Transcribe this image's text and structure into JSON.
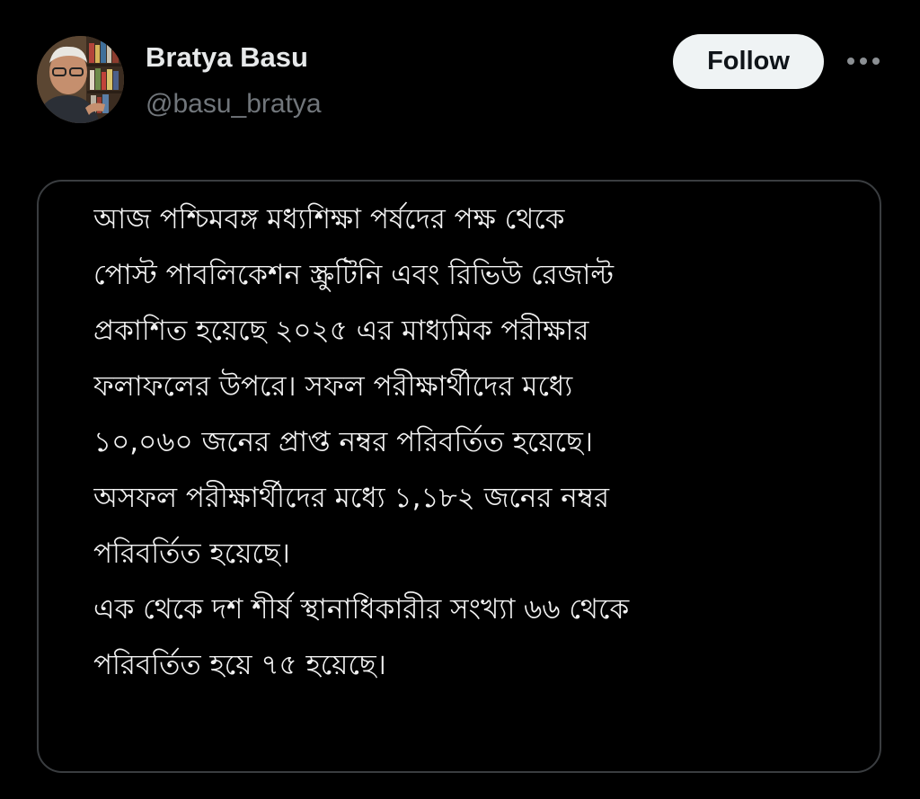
{
  "author": {
    "name": "Bratya Basu",
    "handle": "@basu_bratya"
  },
  "actions": {
    "follow_label": "Follow",
    "more_icon": "more-horizontal-icon"
  },
  "post_image": {
    "lines": [
      "আজ পশ্চিমবঙ্গ মধ্যশিক্ষা পর্ষদের পক্ষ থেকে",
      "পোস্ট পাবলিকেশন স্ক্রুটিনি এবং রিভিউ রেজাল্ট",
      "প্রকাশিত হয়েছে ২০২৫ এর মাধ্যমিক পরীক্ষার",
      "ফলাফলের উপরে। সফল পরীক্ষার্থীদের মধ্যে",
      "১০,০৬০ জনের প্রাপ্ত নম্বর পরিবর্তিত হয়েছে।",
      "অসফল পরীক্ষার্থীদের মধ্যে ১,১৮২ জনের নম্বর",
      "পরিবর্তিত হয়েছে।",
      "এক থেকে দশ শীর্ষ স্থানাধিকারীর সংখ্যা ৬৬ থেকে",
      "পরিবর্তিত হয়ে ৭৫ হয়েছে।"
    ]
  },
  "colors": {
    "background": "#000000",
    "name": "#e7e9ea",
    "handle": "#71767b",
    "follow_bg": "#eff3f4",
    "follow_text": "#0f1419",
    "card_border": "#3a3d40",
    "body_text": "#f2f2f2"
  }
}
